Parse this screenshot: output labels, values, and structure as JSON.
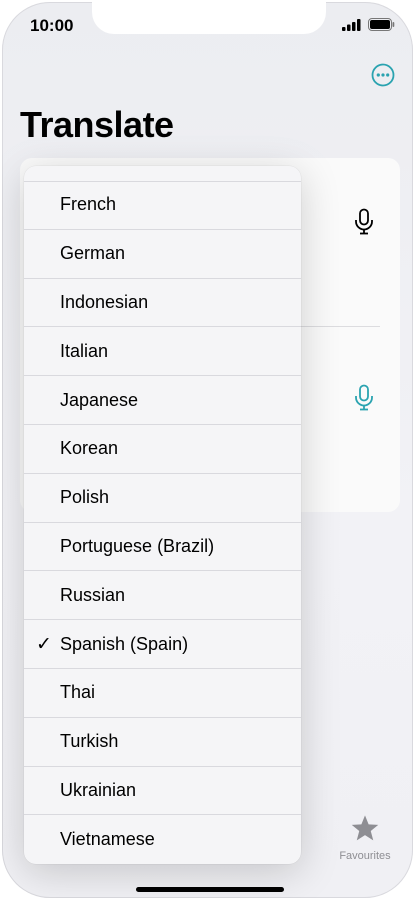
{
  "status": {
    "time": "10:00"
  },
  "page": {
    "title": "Translate"
  },
  "language_menu": {
    "items": [
      {
        "label": "French",
        "selected": false
      },
      {
        "label": "German",
        "selected": false
      },
      {
        "label": "Indonesian",
        "selected": false
      },
      {
        "label": "Italian",
        "selected": false
      },
      {
        "label": "Japanese",
        "selected": false
      },
      {
        "label": "Korean",
        "selected": false
      },
      {
        "label": "Polish",
        "selected": false
      },
      {
        "label": "Portuguese (Brazil)",
        "selected": false
      },
      {
        "label": "Russian",
        "selected": false
      },
      {
        "label": "Spanish (Spain)",
        "selected": true
      },
      {
        "label": "Thai",
        "selected": false
      },
      {
        "label": "Turkish",
        "selected": false
      },
      {
        "label": "Ukrainian",
        "selected": false
      },
      {
        "label": "Vietnamese",
        "selected": false
      }
    ],
    "check_glyph": "✓"
  },
  "tabbar": {
    "favourites_label": "Favourites"
  },
  "icons": {
    "more": "ellipsis-circle-icon",
    "mic": "microphone-icon",
    "star": "star-icon"
  },
  "colors": {
    "accent": "#2aa3b0",
    "text": "#000000",
    "muted": "#8e8e93"
  }
}
